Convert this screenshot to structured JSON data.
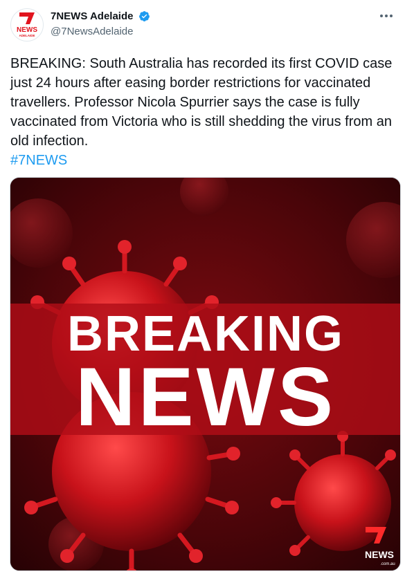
{
  "account": {
    "display_name": "7NEWS Adelaide",
    "handle": "@7NewsAdelaide",
    "avatar_logo_text": "NEWS",
    "avatar_logo_subtext": "ADELAIDE"
  },
  "tweet": {
    "text": "BREAKING: South Australia has recorded its first COVID case just 24 hours after easing border restrictions for vaccinated travellers. Professor Nicola Spurrier says the case is fully vaccinated from Victoria who is still shedding the virus from an old infection.",
    "hashtag": "#7NEWS"
  },
  "media": {
    "headline_line1": "BREAKING",
    "headline_line2": "NEWS",
    "watermark_text": "NEWS",
    "watermark_subtext": ".com.au"
  },
  "colors": {
    "brand_red": "#e1141e",
    "link_blue": "#1d9bf0",
    "verified_blue": "#1d9bf0",
    "banner_red": "#b00d17"
  },
  "icons": {
    "verified": "verified-badge-icon",
    "more": "more-options-icon",
    "logo": "7news-logo-icon"
  }
}
